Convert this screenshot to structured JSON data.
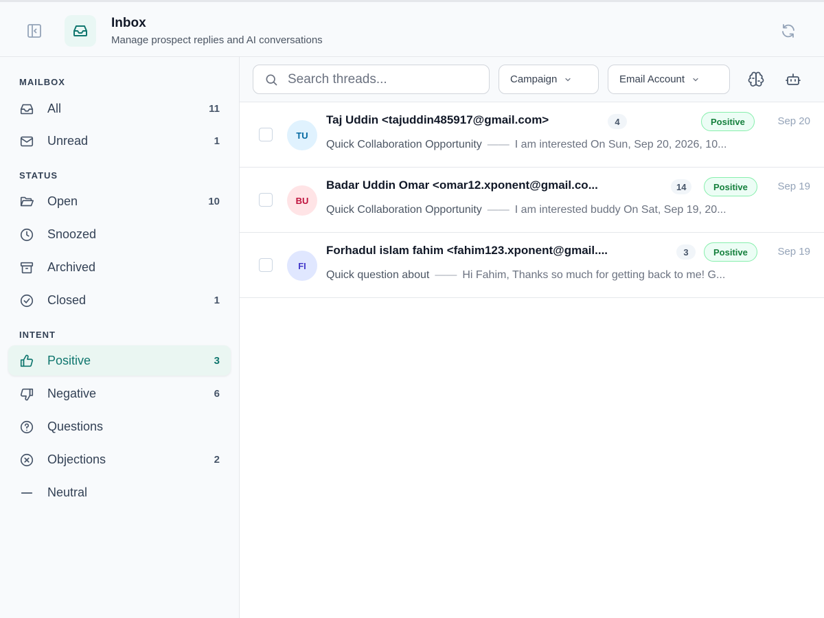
{
  "header": {
    "title": "Inbox",
    "subtitle": "Manage prospect replies and AI conversations",
    "icons": {
      "collapse": "sidebar-collapse-icon",
      "badge": "inbox-icon",
      "refresh": "refresh-icon"
    }
  },
  "sidebar": {
    "mailbox_label": "MAILBOX",
    "status_label": "STATUS",
    "intent_label": "INTENT",
    "mailbox": [
      {
        "label": "All",
        "count": "11",
        "icon": "inbox-icon"
      },
      {
        "label": "Unread",
        "count": "1",
        "icon": "mail-icon"
      }
    ],
    "status": [
      {
        "label": "Open",
        "count": "10",
        "icon": "folder-open-icon"
      },
      {
        "label": "Snoozed",
        "count": "",
        "icon": "clock-icon"
      },
      {
        "label": "Archived",
        "count": "",
        "icon": "archive-icon"
      },
      {
        "label": "Closed",
        "count": "1",
        "icon": "check-circle-icon"
      }
    ],
    "intent": [
      {
        "label": "Positive",
        "count": "3",
        "icon": "thumbs-up-icon",
        "active": true
      },
      {
        "label": "Negative",
        "count": "6",
        "icon": "thumbs-down-icon"
      },
      {
        "label": "Questions",
        "count": "",
        "icon": "help-circle-icon"
      },
      {
        "label": "Objections",
        "count": "2",
        "icon": "x-circle-icon"
      },
      {
        "label": "Neutral",
        "count": "",
        "icon": "minus-icon"
      }
    ]
  },
  "toolbar": {
    "search_placeholder": "Search threads...",
    "campaign_label": "Campaign",
    "email_account_label": "Email Account",
    "icons": [
      "brain-icon",
      "bot-icon"
    ]
  },
  "threads": [
    {
      "initials": "TU",
      "from": "Taj Uddin <tajuddin485917@gmail.com>",
      "count": "4",
      "tag": "Positive",
      "date": "Sep 20",
      "subject": "Quick Collaboration Opportunity",
      "snippet": "I am interested On Sun, Sep 20, 2026, 10...",
      "avatar_bg": "#e0f2fe",
      "avatar_fg": "#0369a1"
    },
    {
      "initials": "BU",
      "from": "Badar Uddin Omar <omar12.xponent@gmail.co...",
      "count": "14",
      "tag": "Positive",
      "date": "Sep 19",
      "subject": "Quick Collaboration Opportunity",
      "snippet": "I am interested buddy On Sat, Sep 19, 20...",
      "avatar_bg": "#ffe4e6",
      "avatar_fg": "#be123c"
    },
    {
      "initials": "FI",
      "from": "Forhadul islam fahim <fahim123.xponent@gmail....",
      "count": "3",
      "tag": "Positive",
      "date": "Sep 19",
      "subject": "Quick question about",
      "snippet": "Hi Fahim, Thanks so much for getting back to me! G...",
      "avatar_bg": "#e0e7ff",
      "avatar_fg": "#4338ca"
    }
  ],
  "colors": {
    "accent": "#0f766e",
    "positive_bg": "#ecfdf5",
    "positive_border": "#86efac",
    "positive_text": "#15803d"
  }
}
